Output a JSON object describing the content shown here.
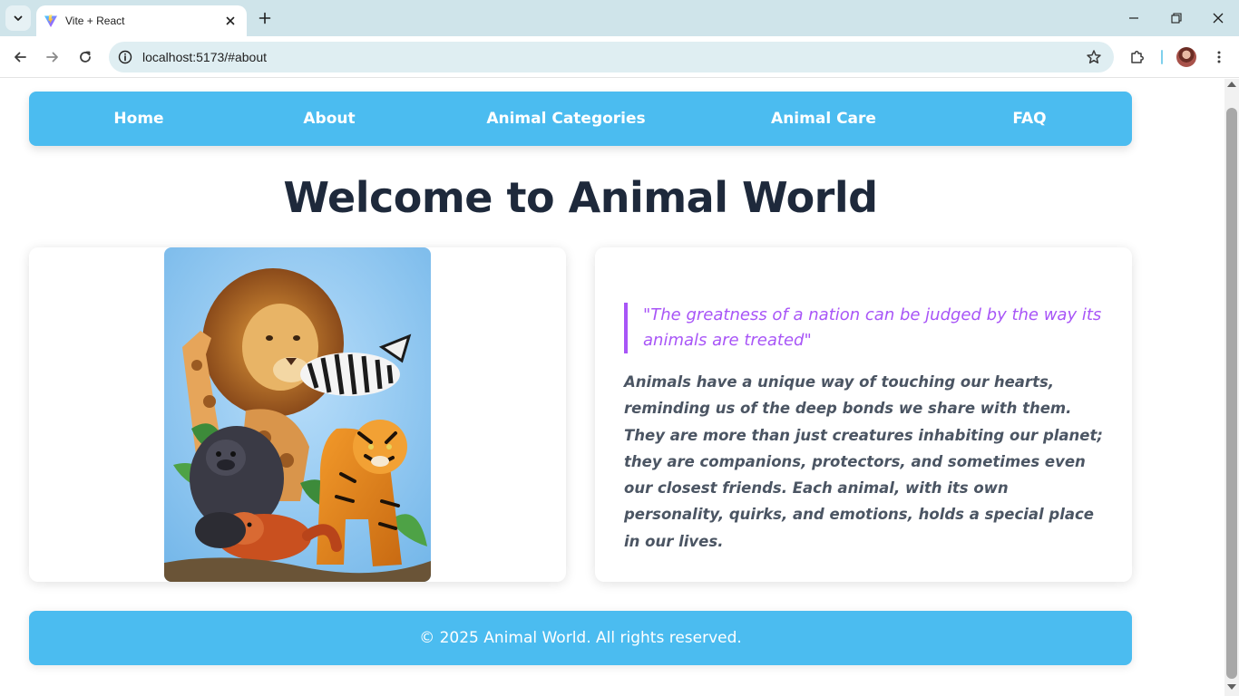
{
  "browser": {
    "tab_title": "Vite + React",
    "url": "localhost:5173/#about"
  },
  "nav": {
    "items": [
      {
        "label": "Home"
      },
      {
        "label": "About"
      },
      {
        "label": "Animal Categories"
      },
      {
        "label": "Animal Care"
      },
      {
        "label": "FAQ"
      }
    ]
  },
  "hero": {
    "title": "Welcome to Animal World"
  },
  "about": {
    "quote": "\"The greatness of a nation can be judged by the way its animals are treated\"",
    "text": "Animals have a unique way of touching our hearts, reminding us of the deep bonds we share with them. They are more than just creatures inhabiting our planet; they are companions, protectors, and sometimes even our closest friends. Each animal, with its own personality, quirks, and emotions, holds a special place in our lives."
  },
  "footer": {
    "text": "© 2025 Animal World. All rights reserved."
  },
  "theme": {
    "primary": "#4bbcf0",
    "quote_color": "#a855f7",
    "heading_color": "#1e293b",
    "body_text_color": "#4b5563"
  },
  "icons": {
    "tab_search": "chevron-down-icon",
    "favicon": "vite-logo-icon",
    "tab_close": "close-icon",
    "new_tab": "plus-icon",
    "back": "arrow-left-icon",
    "forward": "arrow-right-icon",
    "reload": "reload-icon",
    "site_info": "info-icon",
    "bookmark": "star-icon",
    "extensions": "puzzle-icon",
    "menu": "kebab-menu-icon"
  }
}
